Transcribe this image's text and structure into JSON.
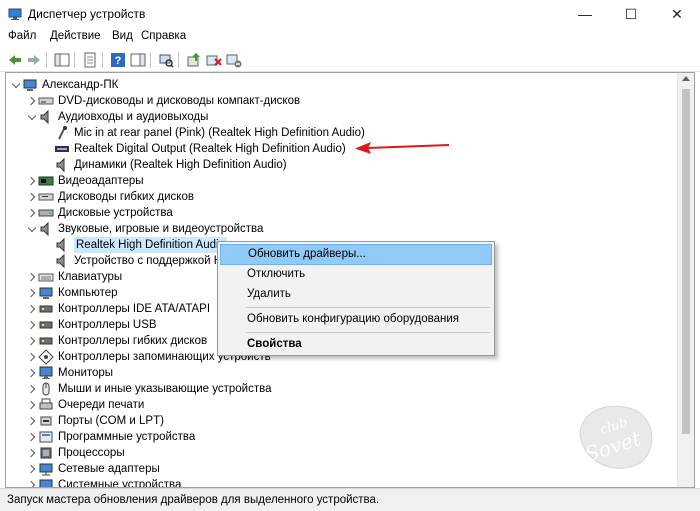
{
  "window": {
    "title": "Диспетчер устройств",
    "min_glyph": "—",
    "max_glyph": "☐",
    "close_glyph": "✕"
  },
  "menu": [
    "Файл",
    "Действие",
    "Вид",
    "Справка"
  ],
  "tree": {
    "root": "Александр-ПК",
    "items": [
      {
        "label": "DVD-дисководы и дисководы компакт-дисков",
        "icon": "dvd-drive-icon",
        "expanded": false
      },
      {
        "label": "Аудиовходы и аудиовыходы",
        "icon": "speaker-icon",
        "expanded": true,
        "children": [
          "Mic in at rear panel (Pink) (Realtek High Definition Audio)",
          "Realtek Digital Output (Realtek High Definition Audio)",
          "Динамики (Realtek High Definition Audio)"
        ]
      },
      {
        "label": "Видеоадаптеры",
        "icon": "display-adapter-icon",
        "expanded": false
      },
      {
        "label": "Дисководы гибких дисков",
        "icon": "floppy-drive-icon",
        "expanded": false
      },
      {
        "label": "Дисковые устройства",
        "icon": "disk-drive-icon",
        "expanded": false
      },
      {
        "label": "Звуковые, игровые и видеоустройства",
        "icon": "sound-device-icon",
        "expanded": true,
        "children": [
          "Realtek High Definition Audio",
          "Устройство с поддержкой H"
        ]
      },
      {
        "label": "Клавиатуры",
        "icon": "keyboard-icon",
        "expanded": false
      },
      {
        "label": "Компьютер",
        "icon": "computer-icon",
        "expanded": false
      },
      {
        "label": "Контроллеры IDE ATA/ATAPI",
        "icon": "ide-controller-icon",
        "expanded": false
      },
      {
        "label": "Контроллеры USB",
        "icon": "usb-controller-icon",
        "expanded": false
      },
      {
        "label": "Контроллеры гибких дисков",
        "icon": "floppy-controller-icon",
        "expanded": false
      },
      {
        "label": "Контроллеры запоминающих устройств",
        "icon": "storage-controller-icon",
        "expanded": false
      },
      {
        "label": "Мониторы",
        "icon": "monitor-icon",
        "expanded": false
      },
      {
        "label": "Мыши и иные указывающие устройства",
        "icon": "mouse-icon",
        "expanded": false
      },
      {
        "label": "Очереди печати",
        "icon": "print-queue-icon",
        "expanded": false
      },
      {
        "label": "Порты (COM и LPT)",
        "icon": "port-icon",
        "expanded": false
      },
      {
        "label": "Программные устройства",
        "icon": "software-device-icon",
        "expanded": false
      },
      {
        "label": "Процессоры",
        "icon": "processor-icon",
        "expanded": false
      },
      {
        "label": "Сетевые адаптеры",
        "icon": "network-adapter-icon",
        "expanded": false
      },
      {
        "label": "Системные устройства",
        "icon": "system-device-icon",
        "expanded": false
      }
    ]
  },
  "context_menu": {
    "update": "Обновить драйверы...",
    "disable": "Отключить",
    "delete": "Удалить",
    "scan": "Обновить конфигурацию оборудования",
    "properties": "Свойства"
  },
  "status": "Запуск мастера обновления драйверов для выделенного устройства.",
  "watermark": "club Sovet",
  "colors": {
    "arrow": "#e0161b",
    "selection": "#cce8ff",
    "menu_highlight": "#91c9f7"
  }
}
